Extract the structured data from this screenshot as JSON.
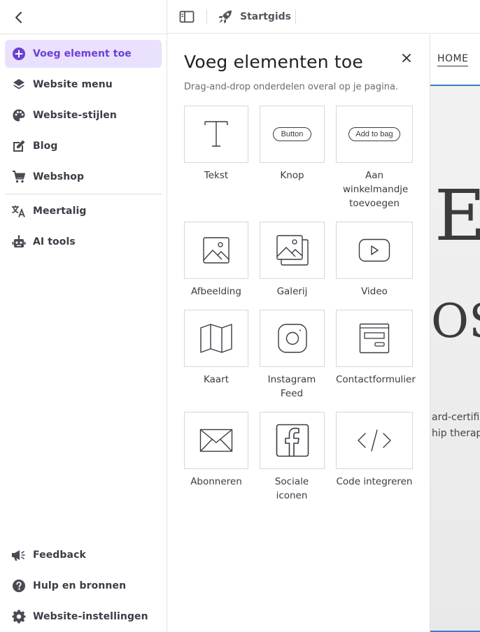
{
  "sidebar": {
    "main_items": [
      {
        "label": "Voeg element toe",
        "icon": "plus-circle-icon"
      },
      {
        "label": "Website menu",
        "icon": "layers-icon"
      },
      {
        "label": "Website-stijlen",
        "icon": "palette-icon"
      },
      {
        "label": "Blog",
        "icon": "edit-icon"
      },
      {
        "label": "Webshop",
        "icon": "cart-icon"
      }
    ],
    "extra_items": [
      {
        "label": "Meertalig",
        "icon": "translate-icon"
      },
      {
        "label": "AI tools",
        "icon": "robot-icon"
      }
    ],
    "bottom_items": [
      {
        "label": "Feedback",
        "icon": "megaphone-icon"
      },
      {
        "label": "Hulp en bronnen",
        "icon": "help-icon"
      },
      {
        "label": "Website-instellingen",
        "icon": "gear-icon"
      }
    ]
  },
  "topbar": {
    "guide_label": "Startgids"
  },
  "panel": {
    "title": "Voeg elementen toe",
    "subtitle": "Drag-and-drop onderdelen overal op je pagina.",
    "tiles": [
      {
        "label": "Tekst",
        "icon": "text-icon"
      },
      {
        "label": "Knop",
        "icon": "button-icon",
        "preview_text": "Button"
      },
      {
        "label": "Aan winkelmandje toevoegen",
        "icon": "add-to-cart-icon",
        "preview_text": "Add to bag"
      },
      {
        "label": "Afbeelding",
        "icon": "image-icon"
      },
      {
        "label": "Galerij",
        "icon": "gallery-icon"
      },
      {
        "label": "Video",
        "icon": "video-icon"
      },
      {
        "label": "Kaart",
        "icon": "map-icon"
      },
      {
        "label": "Instagram Feed",
        "icon": "instagram-icon"
      },
      {
        "label": "Contactformulier",
        "icon": "form-icon"
      },
      {
        "label": "Abonneren",
        "icon": "envelope-icon"
      },
      {
        "label": "Sociale iconen",
        "icon": "facebook-icon"
      },
      {
        "label": "Code integreren",
        "icon": "code-icon"
      }
    ]
  },
  "preview": {
    "nav_home": "HOME",
    "heading_fragment_1": "E",
    "heading_fragment_2": "OS",
    "body_fragment_1": "ard-certifi",
    "body_fragment_2": "hip therap"
  },
  "colors": {
    "accent": "#6b3fd4",
    "active_bg": "#e9e1fd",
    "preview_link": "#3d7bd1"
  }
}
